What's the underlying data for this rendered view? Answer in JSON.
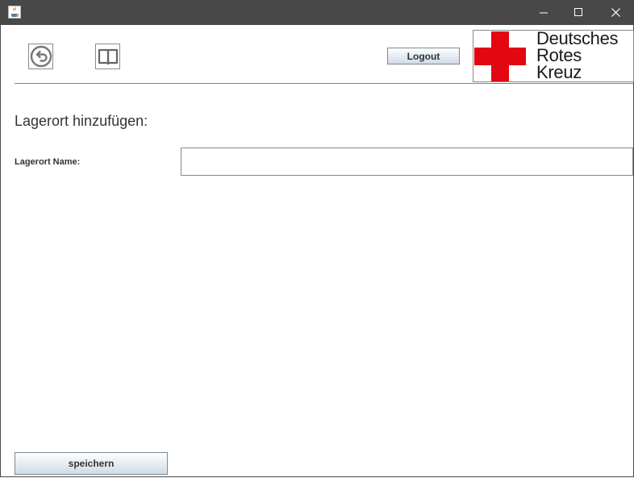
{
  "window": {
    "app_icon": "java-cup-icon",
    "controls": [
      "minimize-icon",
      "maximize-icon",
      "close-icon"
    ]
  },
  "toolbar": {
    "back_icon": "back-arrow-icon",
    "manual_icon": "book-icon",
    "logout_label": "Logout"
  },
  "logo": {
    "line1": "Deutsches",
    "line2": "Rotes",
    "line3": "Kreuz",
    "cross_color": "#e30613"
  },
  "form": {
    "title": "Lagerort hinzufügen:",
    "name_label": "Lagerort Name:",
    "name_value": "",
    "save_label": "speichern"
  },
  "colors": {
    "titlebar": "#484848",
    "separator": "#6f8aa3"
  }
}
